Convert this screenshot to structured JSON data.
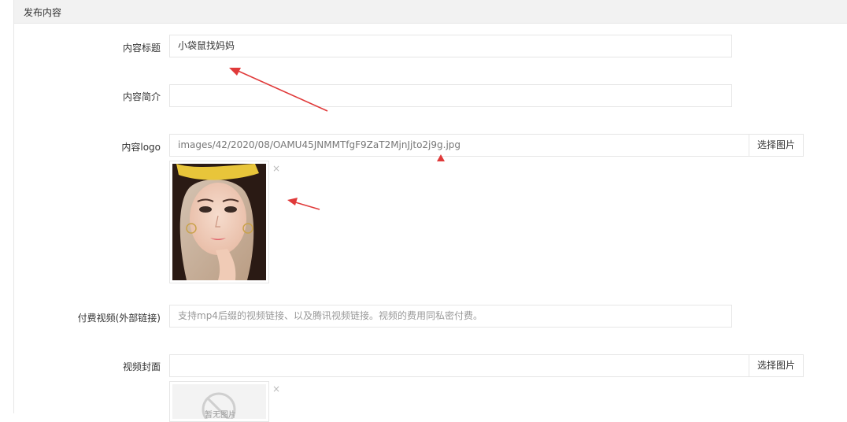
{
  "panel": {
    "title": "发布内容"
  },
  "form": {
    "title_field": {
      "label": "内容标题",
      "value": "小袋鼠找妈妈"
    },
    "summary_field": {
      "label": "内容简介",
      "value": ""
    },
    "logo_field": {
      "label": "内容logo",
      "value": "images/42/2020/08/OAMU45JNMMTfgF9ZaT2MjnJjto2j9g.jpg",
      "button": "选择图片",
      "remove_glyph": "×"
    },
    "video_field": {
      "label": "付费视频(外部链接)",
      "placeholder": "支持mp4后缀的视频链接、以及腾讯视频链接。视频的费用同私密付费。"
    },
    "cover_field": {
      "label": "视频封面",
      "value": "",
      "button": "选择图片",
      "remove_glyph": "×",
      "empty_image_text": "暂无图片"
    }
  },
  "annotation_color": "#e03a3a"
}
